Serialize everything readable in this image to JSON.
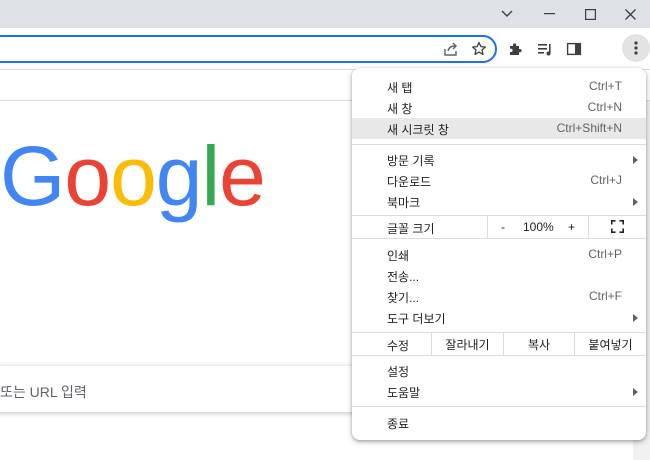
{
  "window": {
    "minimize_icon": "minimize-icon",
    "maximize_icon": "maximize-icon",
    "close_icon": "close-icon",
    "tab_list_icon": "chevron-down-icon"
  },
  "toolbar": {
    "share_icon": "share-icon",
    "bookmark_icon": "star-icon",
    "extensions_icon": "puzzle-icon",
    "media_icon": "media-queue-icon",
    "side_panel_icon": "side-panel-icon",
    "menu_icon": "kebab-icon"
  },
  "page": {
    "logo": {
      "letters": [
        "G",
        "o",
        "o",
        "g",
        "l",
        "e"
      ]
    },
    "search_placeholder": "또는 URL 입력"
  },
  "menu": {
    "items": [
      {
        "label": "새 탭",
        "shortcut": "Ctrl+T"
      },
      {
        "label": "새 창",
        "shortcut": "Ctrl+N"
      },
      {
        "label": "새 시크릿 창",
        "shortcut": "Ctrl+Shift+N"
      },
      {
        "label": "방문 기록",
        "shortcut": ""
      },
      {
        "label": "다운로드",
        "shortcut": "Ctrl+J"
      },
      {
        "label": "북마크",
        "shortcut": ""
      },
      {
        "label": "인쇄",
        "shortcut": "Ctrl+P"
      },
      {
        "label": "전송...",
        "shortcut": ""
      },
      {
        "label": "찾기...",
        "shortcut": "Ctrl+F"
      },
      {
        "label": "도구 더보기",
        "shortcut": ""
      },
      {
        "label": "설정",
        "shortcut": ""
      },
      {
        "label": "도움말",
        "shortcut": ""
      },
      {
        "label": "종료",
        "shortcut": ""
      }
    ],
    "zoom": {
      "label": "글꼴 크기",
      "minus": "-",
      "value": "100%",
      "plus": "+",
      "fullscreen_icon": "fullscreen-icon"
    },
    "edit": {
      "label": "수정",
      "cut": "잘라내기",
      "copy": "복사",
      "paste": "붙여넣기"
    }
  }
}
